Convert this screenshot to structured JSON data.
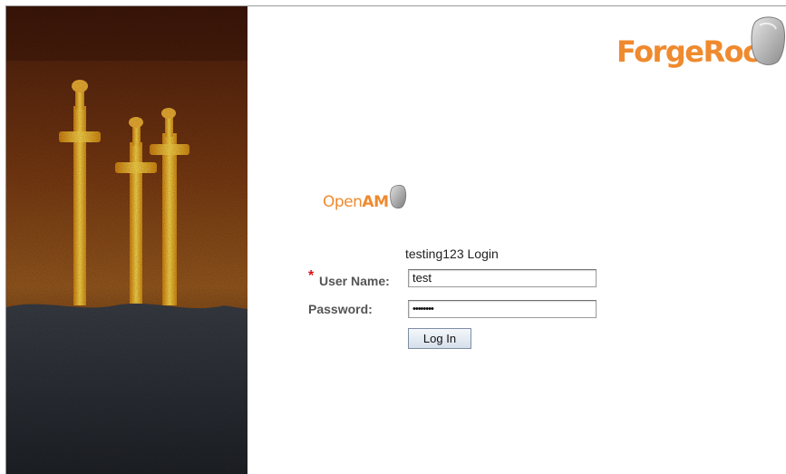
{
  "branding": {
    "forgerock_logo": "ForgeRock",
    "openam_logo_open": "Open",
    "openam_logo_am": "AM",
    "accent_color": "#ef8a2e"
  },
  "login": {
    "title": "testing123 Login",
    "required_marker": "*",
    "username_label": "User Name:",
    "username_value": "test",
    "password_label": "Password:",
    "password_value": "••••••••",
    "submit_label": "Log In"
  }
}
